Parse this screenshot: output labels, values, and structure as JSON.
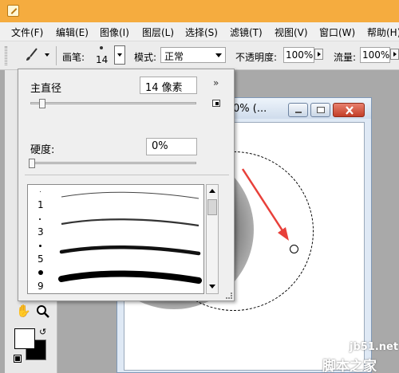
{
  "menubar": {
    "items": [
      "文件(F)",
      "编辑(E)",
      "图像(I)",
      "图层(L)",
      "选择(S)",
      "滤镜(T)",
      "视图(V)",
      "窗口(W)",
      "帮助(H)"
    ]
  },
  "toolbar": {
    "brush_label": "画笔:",
    "brush_size": "14",
    "mode_label": "模式:",
    "mode_value": "正常",
    "opacity_label": "不透明度:",
    "opacity_value": "100%",
    "flow_label": "流量:",
    "flow_value": "100%"
  },
  "document": {
    "title": "0% (..."
  },
  "brush_panel": {
    "diameter_label": "主直径",
    "diameter_value": "14 像素",
    "hardness_label": "硬度:",
    "hardness_value": "0%",
    "menu_arrows": "»",
    "presets": [
      {
        "size": "1"
      },
      {
        "size": "3"
      },
      {
        "size": "5"
      },
      {
        "size": "9"
      }
    ]
  },
  "colors": {
    "foreground": "#ffffff",
    "background": "#000000",
    "annotation": "#e8403a",
    "title_bar": "#f5ac3f"
  },
  "watermark": {
    "en": "jb51.net",
    "cn": "脚本之家"
  }
}
